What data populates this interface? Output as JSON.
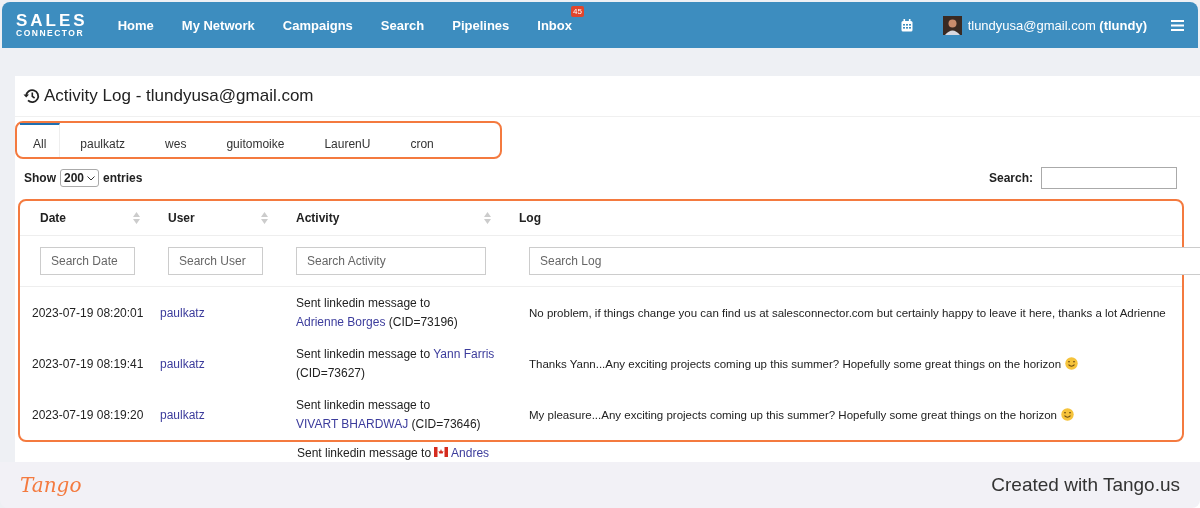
{
  "nav": {
    "logo": {
      "line1": "SALES",
      "line2": "CONNECTOR"
    },
    "links": [
      {
        "label": "Home"
      },
      {
        "label": "My Network"
      },
      {
        "label": "Campaigns"
      },
      {
        "label": "Search"
      },
      {
        "label": "Pipelines"
      },
      {
        "label": "Inbox",
        "badge": "45"
      }
    ],
    "user": {
      "email": "tlundyusa@gmail.com",
      "username": "(tlundy)"
    }
  },
  "page_title": "Activity Log - tlundyusa@gmail.com",
  "tabs": [
    {
      "label": "All",
      "selected": true
    },
    {
      "label": "paulkatz",
      "selected": false
    },
    {
      "label": "wes",
      "selected": false
    },
    {
      "label": "guitomoike",
      "selected": false
    },
    {
      "label": "LaurenU",
      "selected": false
    },
    {
      "label": "cron",
      "selected": false
    }
  ],
  "length_menu": {
    "show": "Show",
    "value": "200",
    "entries": "entries"
  },
  "search": {
    "label": "Search:"
  },
  "table": {
    "columns": [
      {
        "label": "Date",
        "placeholder": "Search Date",
        "sortable": true
      },
      {
        "label": "User",
        "placeholder": "Search User",
        "sortable": true
      },
      {
        "label": "Activity",
        "placeholder": "Search Activity",
        "sortable": true
      },
      {
        "label": "Log",
        "placeholder": "Search Log",
        "sortable": false
      }
    ],
    "rows": [
      {
        "date": "2023-07-19 08:20:01",
        "user": "paulkatz",
        "activity": {
          "prefix": "Sent linkedin message to",
          "contact": "Adrienne Borges",
          "suffix": "(CID=73196)"
        },
        "log": "No problem, if things change you can find us at salesconnector.com but certainly happy to leave it here, thanks a lot Adrienne",
        "smiley": false
      },
      {
        "date": "2023-07-19 08:19:41",
        "user": "paulkatz",
        "activity": {
          "prefix": "Sent linkedin message to",
          "contact": "Yann Farris",
          "suffix": "(CID=73627)"
        },
        "log": "Thanks Yann...Any exciting projects coming up this summer? Hopefully some great things on the horizon",
        "smiley": true
      },
      {
        "date": "2023-07-19 08:19:20",
        "user": "paulkatz",
        "activity": {
          "prefix": "Sent linkedin message to",
          "contact": "VIVART BHARDWAJ",
          "suffix": "(CID=73646)"
        },
        "log": "My pleasure...Any exciting projects coming up this summer? Hopefully some great things on the horizon",
        "smiley": true
      }
    ],
    "partial_row": {
      "activity": {
        "prefix": "Sent linkedin message to",
        "flag": true,
        "contact": "Andres"
      }
    }
  },
  "footer": {
    "brand": "Tango",
    "text": "Created with Tango.us"
  }
}
